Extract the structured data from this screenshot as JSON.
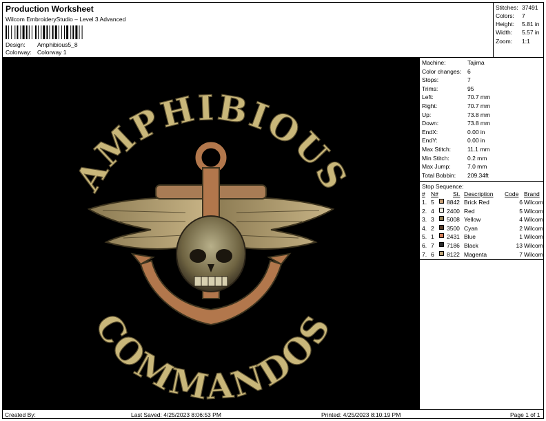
{
  "header": {
    "title": "Production Worksheet",
    "subtitle": "Wilcom EmbroideryStudio – Level 3 Advanced",
    "design_label": "Design:",
    "design_value": "Amphibious5_8",
    "colorway_label": "Colorway:",
    "colorway_value": "Colorway 1"
  },
  "stats": {
    "stitches_label": "Stitches:",
    "stitches": "37491",
    "colors_label": "Colors:",
    "colors": "7",
    "height_label": "Height:",
    "height": "5.81 in",
    "width_label": "Width:",
    "width": "5.57 in",
    "zoom_label": "Zoom:",
    "zoom": "1:1"
  },
  "artwork": {
    "top_text": "AMPHIBIOUS",
    "bottom_text": "COMMANDOS",
    "colors": {
      "background": "#000000",
      "thread_gold": "#c9b77a",
      "thread_copper": "#b2774c",
      "thread_olive": "#8c7a4a"
    }
  },
  "machine": {
    "rows": [
      {
        "label": "Machine:",
        "value": "Tajima"
      },
      {
        "label": "Color changes:",
        "value": "6"
      },
      {
        "label": "Stops:",
        "value": "7"
      },
      {
        "label": "Trims:",
        "value": "95"
      },
      {
        "label": "Left:",
        "value": "70.7 mm"
      },
      {
        "label": "Right:",
        "value": "70.7 mm"
      },
      {
        "label": "Up:",
        "value": "73.8 mm"
      },
      {
        "label": "Down:",
        "value": "73.8 mm"
      },
      {
        "label": "EndX:",
        "value": "0.00 in"
      },
      {
        "label": "EndY:",
        "value": "0.00 in"
      },
      {
        "label": "Max Stitch:",
        "value": "11.1 mm"
      },
      {
        "label": "Min Stitch:",
        "value": "0.2 mm"
      },
      {
        "label": "Max Jump:",
        "value": "7.0 mm"
      },
      {
        "label": "Total Bobbin:",
        "value": "209.34ft"
      }
    ]
  },
  "stop_sequence": {
    "title": "Stop Sequence:",
    "headers": {
      "num": "#",
      "n": "N#",
      "st": "St.",
      "description": "Description",
      "code": "Code",
      "brand": "Brand"
    },
    "rows": [
      {
        "num": "1.",
        "n": "5",
        "swatch": "#c79e74",
        "st": "8842",
        "description": "Brick Red",
        "code": "6",
        "brand": "Wilcom"
      },
      {
        "num": "2.",
        "n": "4",
        "swatch": "#f3efe3",
        "st": "2400",
        "description": "Red",
        "code": "5",
        "brand": "Wilcom"
      },
      {
        "num": "3.",
        "n": "3",
        "swatch": "#948155",
        "st": "5008",
        "description": "Yellow",
        "code": "4",
        "brand": "Wilcom"
      },
      {
        "num": "4.",
        "n": "2",
        "swatch": "#5a3f2b",
        "st": "3500",
        "description": "Cyan",
        "code": "2",
        "brand": "Wilcom"
      },
      {
        "num": "5.",
        "n": "1",
        "swatch": "#d27e58",
        "st": "2431",
        "description": "Blue",
        "code": "1",
        "brand": "Wilcom"
      },
      {
        "num": "6.",
        "n": "7",
        "swatch": "#2a2a2a",
        "st": "7186",
        "description": "Black",
        "code": "13",
        "brand": "Wilcom"
      },
      {
        "num": "7.",
        "n": "6",
        "swatch": "#bba377",
        "st": "8122",
        "description": "Magenta",
        "code": "7",
        "brand": "Wilcom"
      }
    ]
  },
  "footer": {
    "created_by": "Created By:",
    "last_saved": "Last Saved: 4/25/2023 8:06:53 PM",
    "printed": "Printed: 4/25/2023 8:10:19 PM",
    "page": "Page 1 of 1"
  }
}
